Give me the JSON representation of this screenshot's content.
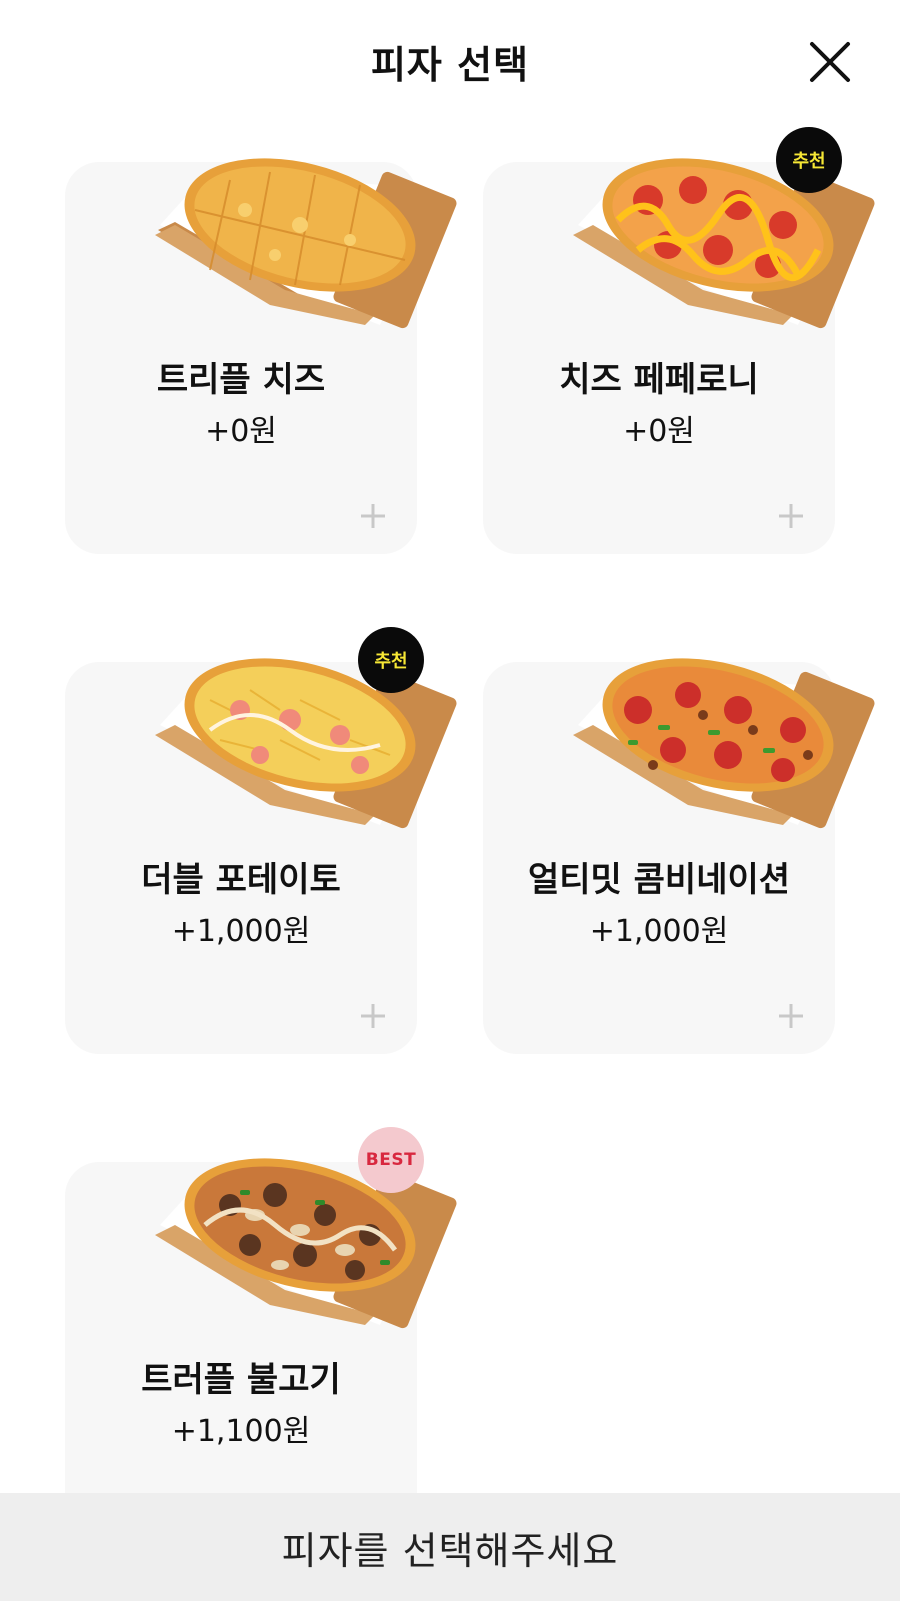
{
  "header": {
    "title": "피자 선택",
    "close_icon": "close-icon"
  },
  "pizzas": [
    {
      "name": "트리플 치즈",
      "price": "+0원",
      "badge": ""
    },
    {
      "name": "치즈 페페로니",
      "price": "+0원",
      "badge": "추천"
    },
    {
      "name": "더블 포테이토",
      "price": "+1,000원",
      "badge": "추천"
    },
    {
      "name": "얼티밋 콤비네이션",
      "price": "+1,000원",
      "badge": ""
    },
    {
      "name": "트러플 불고기",
      "price": "+1,100원",
      "badge": "BEST"
    }
  ],
  "add_icon": "plus-icon",
  "bottom_bar": {
    "label": "피자를 선택해주세요"
  },
  "colors": {
    "card_bg": "#f7f7f7",
    "recommend_badge_bg": "#0a0a0a",
    "recommend_badge_text": "#f6e735",
    "best_badge_bg": "#f4c9ce",
    "best_badge_text": "#d8283f",
    "bottom_bar_bg": "#eeeeee"
  }
}
